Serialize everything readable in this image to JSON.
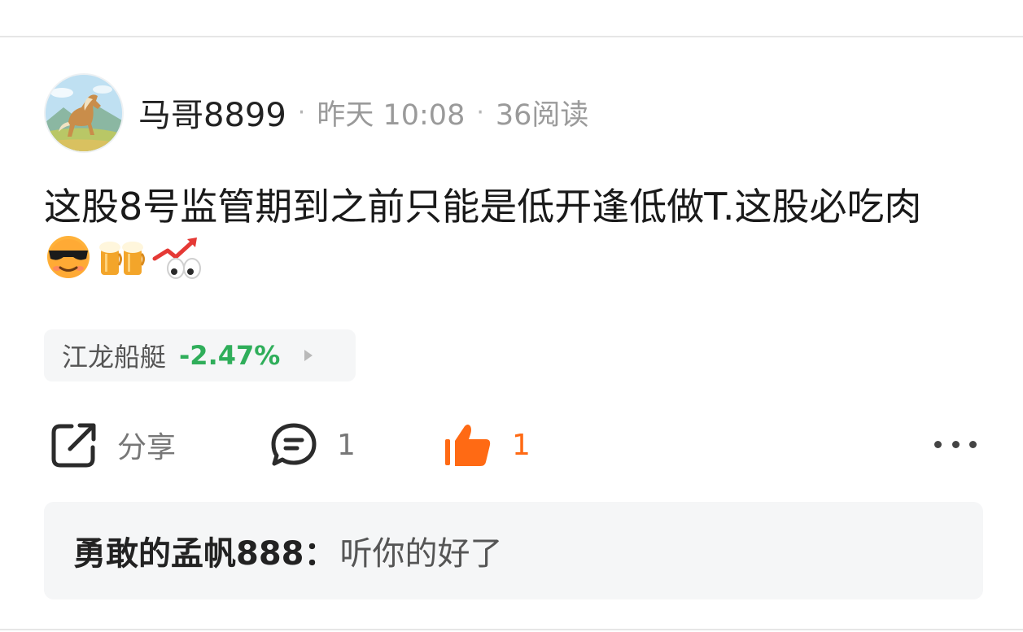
{
  "post": {
    "author": "马哥8899",
    "separator": "·",
    "time": "昨天 10:08",
    "reads": "36阅读",
    "text": "这股8号监管期到之前只能是低开逢低做T.这股必吃肉",
    "emojis": [
      "sunglasses-face",
      "beer-mugs",
      "rising-chart-eyes"
    ]
  },
  "stock": {
    "name": "江龙船艇",
    "change": "-2.47%",
    "change_color": "#2fae5a"
  },
  "actions": {
    "share_label": "分享",
    "comment_count": "1",
    "like_count": "1",
    "like_color": "#ff6a14"
  },
  "comment": {
    "author": "勇敢的孟帆888",
    "colon": "：",
    "text": "听你的好了"
  }
}
